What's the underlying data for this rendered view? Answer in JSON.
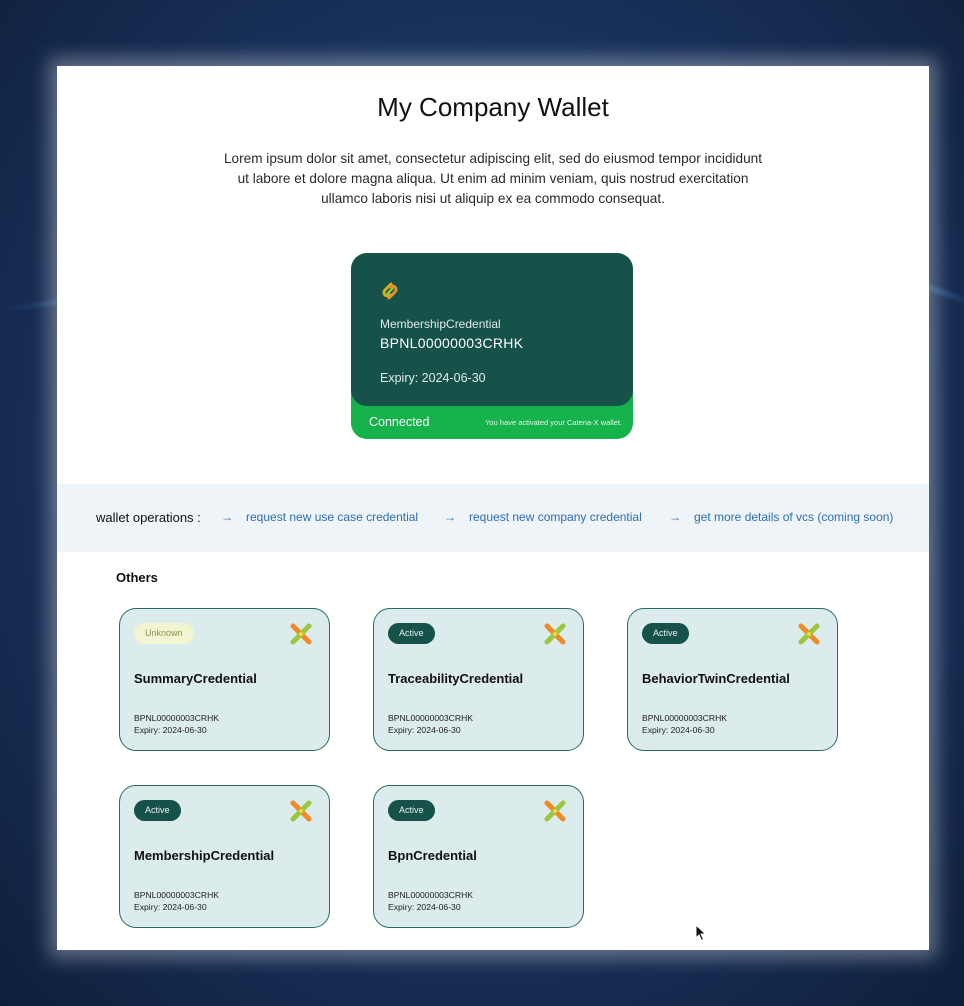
{
  "page": {
    "title": "My Company Wallet",
    "description": "Lorem ipsum dolor sit amet, consectetur adipiscing elit, sed do eiusmod tempor incididunt ut labore et dolore magna aliqua. Ut enim ad minim veniam, quis nostrud exercitation ullamco laboris nisi ut aliquip ex ea commodo consequat."
  },
  "main_credential": {
    "logo_icon": "catena-x-link-icon",
    "type": "MembershipCredential",
    "bpn": "BPNL00000003CRHK",
    "expiry": "Expiry: 2024-06-30",
    "status": "Connected",
    "status_note": "You have activated your Catena-X wallet."
  },
  "operations": {
    "label": "wallet operations :",
    "arrow_icon": "arrow-right-icon",
    "items": [
      {
        "arrow": "→",
        "label": "request new use case credential"
      },
      {
        "arrow": "→",
        "label": "request new company credential"
      },
      {
        "arrow": "→",
        "label": "get more details of vcs (coming soon)"
      }
    ]
  },
  "others": {
    "heading": "Others",
    "logo_icon": "catena-x-cross-icon",
    "cards": [
      {
        "status": "Unknown",
        "name": "SummaryCredential",
        "bpn": "BPNL00000003CRHK",
        "expiry": "Expiry: 2024-06-30"
      },
      {
        "status": "Active",
        "name": "TraceabilityCredential",
        "bpn": "BPNL00000003CRHK",
        "expiry": "Expiry: 2024-06-30"
      },
      {
        "status": "Active",
        "name": "BehaviorTwinCredential",
        "bpn": "BPNL00000003CRHK",
        "expiry": "Expiry: 2024-06-30"
      },
      {
        "status": "Active",
        "name": "MembershipCredential",
        "bpn": "BPNL00000003CRHK",
        "expiry": "Expiry: 2024-06-30"
      },
      {
        "status": "Active",
        "name": "BpnCredential",
        "bpn": "BPNL00000003CRHK",
        "expiry": "Expiry: 2024-06-30"
      }
    ]
  },
  "colors": {
    "card_dark_green": "#16524a",
    "connected_green": "#16b24b",
    "link_blue": "#2f6db2",
    "card_bg": "#dcebeb",
    "unknown_badge": "#f2f5d2"
  }
}
